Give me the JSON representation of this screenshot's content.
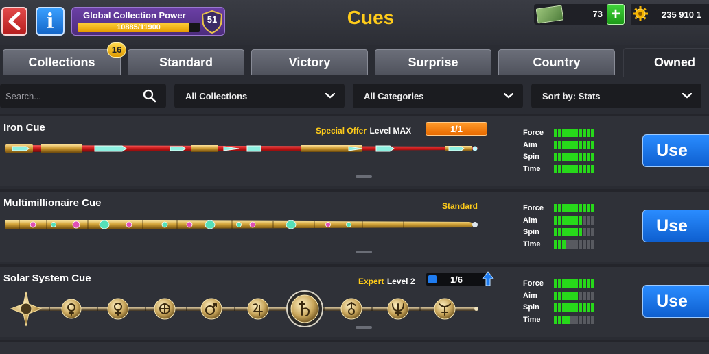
{
  "header": {
    "title": "Cues",
    "collection_power": {
      "title": "Global Collection Power",
      "progress_text": "10885/11900",
      "progress_fraction": 0.915,
      "level": "51"
    },
    "cash": "73",
    "coins": "235 910 1",
    "add_label": "+"
  },
  "tabs": [
    {
      "label": "Collections",
      "badge": "16"
    },
    {
      "label": "Standard"
    },
    {
      "label": "Victory"
    },
    {
      "label": "Surprise"
    },
    {
      "label": "Country"
    },
    {
      "label": "Owned",
      "active": true
    }
  ],
  "filters": {
    "search_placeholder": "Search...",
    "collection": "All Collections",
    "category": "All Categories",
    "sort": "Sort by: Stats"
  },
  "stat_labels": [
    "Force",
    "Aim",
    "Spin",
    "Time"
  ],
  "cues": [
    {
      "name": "Iron Cue",
      "tag": "Special Offer",
      "level_text": "Level MAX",
      "pieces": "1/1",
      "stats": [
        10,
        10,
        10,
        10
      ],
      "use_label": "Use"
    },
    {
      "name": "Multimillionaire Cue",
      "tag": "Standard",
      "stats": [
        10,
        7,
        7,
        3
      ],
      "use_label": "Use"
    },
    {
      "name": "Solar System Cue",
      "tag": "Expert",
      "level_text": "Level 2",
      "pieces": "1/6",
      "stats": [
        10,
        6,
        10,
        4
      ],
      "use_label": "Use"
    }
  ],
  "colors": {
    "accent_yellow": "#ffcc1a",
    "use_blue": "#1a74e8",
    "stat_green": "#27d81a",
    "panel": "#2f3138"
  }
}
